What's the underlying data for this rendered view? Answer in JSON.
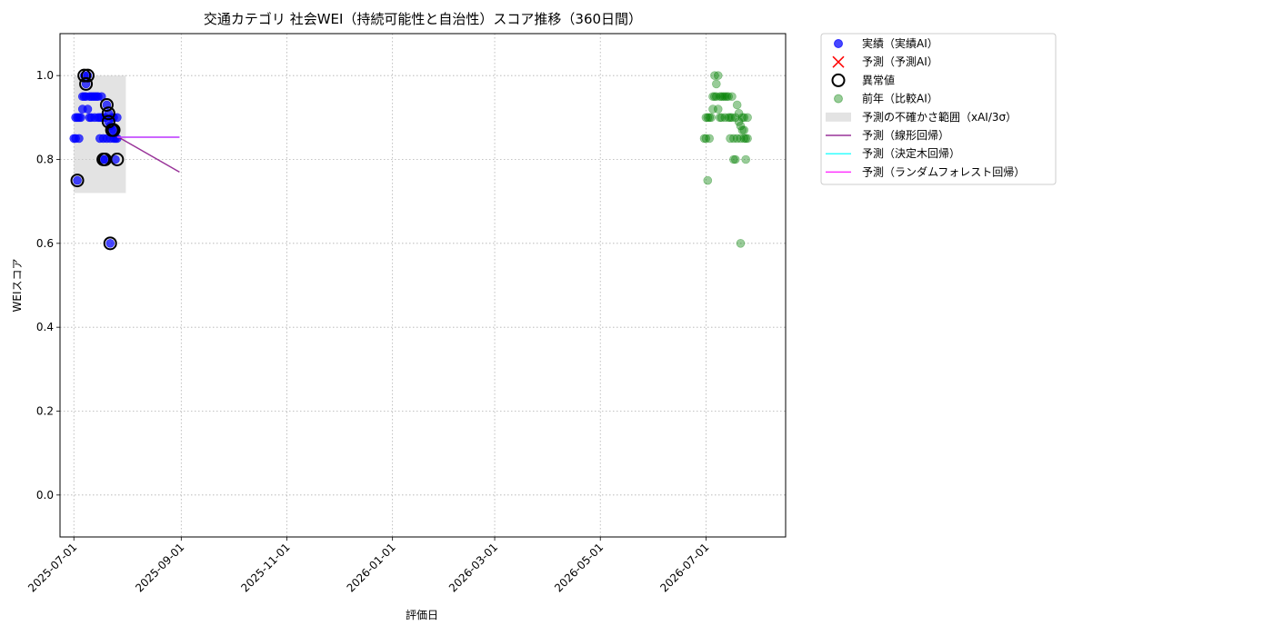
{
  "chart_data": {
    "type": "scatter",
    "title": "交通カテゴリ 社会WEI（持続可能性と自治性）スコア推移（360日間）",
    "xlabel": "評価日",
    "ylabel": "WEIスコア",
    "xlim": [
      "2025-06-23",
      "2026-08-16"
    ],
    "ylim": [
      -0.1,
      1.1
    ],
    "grid": true,
    "legend_position": "outside-top-right",
    "x_tick_labels": [
      "2025-07-01",
      "2025-09-01",
      "2025-11-01",
      "2026-01-01",
      "2026-03-01",
      "2026-05-01",
      "2026-07-01"
    ],
    "y_tick_values": [
      0.0,
      0.2,
      0.4,
      0.6,
      0.8,
      1.0
    ],
    "y_tick_labels": [
      "0.0",
      "0.2",
      "0.4",
      "0.6",
      "0.8",
      "1.0"
    ],
    "series": [
      {
        "name": "実績（実績AI）",
        "kind": "scatter",
        "color": "#0000ff",
        "points": [
          [
            "2025-07-01",
            0.85
          ],
          [
            "2025-07-02",
            0.85
          ],
          [
            "2025-07-02",
            0.9
          ],
          [
            "2025-07-03",
            0.75
          ],
          [
            "2025-07-03",
            0.9
          ],
          [
            "2025-07-04",
            0.85
          ],
          [
            "2025-07-04",
            0.9
          ],
          [
            "2025-07-05",
            0.9
          ],
          [
            "2025-07-06",
            0.92
          ],
          [
            "2025-07-06",
            0.95
          ],
          [
            "2025-07-07",
            0.95
          ],
          [
            "2025-07-07",
            1.0
          ],
          [
            "2025-07-08",
            0.98
          ],
          [
            "2025-07-08",
            0.95
          ],
          [
            "2025-07-09",
            1.0
          ],
          [
            "2025-07-09",
            0.92
          ],
          [
            "2025-07-10",
            0.9
          ],
          [
            "2025-07-10",
            0.95
          ],
          [
            "2025-07-11",
            0.95
          ],
          [
            "2025-07-11",
            0.9
          ],
          [
            "2025-07-12",
            0.95
          ],
          [
            "2025-07-13",
            0.9
          ],
          [
            "2025-07-13",
            0.95
          ],
          [
            "2025-07-14",
            0.95
          ],
          [
            "2025-07-15",
            0.9
          ],
          [
            "2025-07-15",
            0.95
          ],
          [
            "2025-07-16",
            0.85
          ],
          [
            "2025-07-16",
            0.9
          ],
          [
            "2025-07-17",
            0.9
          ],
          [
            "2025-07-17",
            0.95
          ],
          [
            "2025-07-18",
            0.85
          ],
          [
            "2025-07-18",
            0.8
          ],
          [
            "2025-07-19",
            0.8
          ],
          [
            "2025-07-19",
            0.9
          ],
          [
            "2025-07-20",
            0.93
          ],
          [
            "2025-07-20",
            0.85
          ],
          [
            "2025-07-21",
            0.89
          ],
          [
            "2025-07-21",
            0.91
          ],
          [
            "2025-07-22",
            0.6
          ],
          [
            "2025-07-22",
            0.88
          ],
          [
            "2025-07-22",
            0.85
          ],
          [
            "2025-07-23",
            0.87
          ],
          [
            "2025-07-23",
            0.9
          ],
          [
            "2025-07-24",
            0.85
          ],
          [
            "2025-07-24",
            0.87
          ],
          [
            "2025-07-24",
            0.9
          ],
          [
            "2025-07-25",
            0.85
          ],
          [
            "2025-07-25",
            0.8
          ],
          [
            "2025-07-26",
            0.85
          ],
          [
            "2025-07-26",
            0.9
          ]
        ]
      },
      {
        "name": "予測（予測AI）",
        "kind": "scatter-x",
        "color": "#ff0000",
        "points": []
      },
      {
        "name": "異常値",
        "kind": "ring",
        "color": "#000000",
        "points": [
          [
            "2025-07-03",
            0.75
          ],
          [
            "2025-07-07",
            1.0
          ],
          [
            "2025-07-08",
            0.98
          ],
          [
            "2025-07-09",
            1.0
          ],
          [
            "2025-07-18",
            0.8
          ],
          [
            "2025-07-19",
            0.8
          ],
          [
            "2025-07-20",
            0.93
          ],
          [
            "2025-07-21",
            0.91
          ],
          [
            "2025-07-21",
            0.89
          ],
          [
            "2025-07-22",
            0.6
          ],
          [
            "2025-07-23",
            0.87
          ],
          [
            "2025-07-24",
            0.87
          ],
          [
            "2025-07-26",
            0.8
          ]
        ]
      },
      {
        "name": "前年（比較AI）",
        "kind": "scatter",
        "color": "#008000",
        "points": [
          [
            "2026-06-30",
            0.85
          ],
          [
            "2026-07-01",
            0.85
          ],
          [
            "2026-07-01",
            0.9
          ],
          [
            "2026-07-02",
            0.75
          ],
          [
            "2026-07-02",
            0.9
          ],
          [
            "2026-07-03",
            0.85
          ],
          [
            "2026-07-03",
            0.9
          ],
          [
            "2026-07-04",
            0.9
          ],
          [
            "2026-07-05",
            0.92
          ],
          [
            "2026-07-05",
            0.95
          ],
          [
            "2026-07-06",
            0.95
          ],
          [
            "2026-07-06",
            1.0
          ],
          [
            "2026-07-07",
            0.98
          ],
          [
            "2026-07-07",
            0.95
          ],
          [
            "2026-07-08",
            1.0
          ],
          [
            "2026-07-08",
            0.92
          ],
          [
            "2026-07-09",
            0.9
          ],
          [
            "2026-07-09",
            0.95
          ],
          [
            "2026-07-10",
            0.95
          ],
          [
            "2026-07-10",
            0.9
          ],
          [
            "2026-07-11",
            0.95
          ],
          [
            "2026-07-12",
            0.9
          ],
          [
            "2026-07-12",
            0.95
          ],
          [
            "2026-07-13",
            0.95
          ],
          [
            "2026-07-14",
            0.9
          ],
          [
            "2026-07-14",
            0.95
          ],
          [
            "2026-07-15",
            0.85
          ],
          [
            "2026-07-15",
            0.9
          ],
          [
            "2026-07-16",
            0.9
          ],
          [
            "2026-07-16",
            0.95
          ],
          [
            "2026-07-17",
            0.85
          ],
          [
            "2026-07-17",
            0.8
          ],
          [
            "2026-07-18",
            0.8
          ],
          [
            "2026-07-18",
            0.9
          ],
          [
            "2026-07-19",
            0.93
          ],
          [
            "2026-07-19",
            0.85
          ],
          [
            "2026-07-20",
            0.89
          ],
          [
            "2026-07-20",
            0.91
          ],
          [
            "2026-07-21",
            0.6
          ],
          [
            "2026-07-21",
            0.88
          ],
          [
            "2026-07-21",
            0.85
          ],
          [
            "2026-07-22",
            0.87
          ],
          [
            "2026-07-22",
            0.9
          ],
          [
            "2026-07-23",
            0.85
          ],
          [
            "2026-07-23",
            0.87
          ],
          [
            "2026-07-23",
            0.9
          ],
          [
            "2026-07-24",
            0.85
          ],
          [
            "2026-07-24",
            0.8
          ],
          [
            "2026-07-25",
            0.85
          ],
          [
            "2026-07-25",
            0.9
          ]
        ]
      },
      {
        "name": "予測の不確かさ範囲（xAI/3σ）",
        "kind": "band",
        "color": "#cccccc",
        "x_range": [
          "2025-07-01",
          "2025-07-31"
        ],
        "y_range": [
          0.72,
          1.0
        ]
      },
      {
        "name": "予測（線形回帰）",
        "kind": "line",
        "color": "#800080",
        "points": [
          [
            "2025-07-26",
            0.855
          ],
          [
            "2025-08-31",
            0.77
          ]
        ]
      },
      {
        "name": "予測（決定木回帰）",
        "kind": "line",
        "color": "#00ffff",
        "points": [
          [
            "2025-07-26",
            0.853
          ],
          [
            "2025-08-31",
            0.853
          ]
        ]
      },
      {
        "name": "予測（ランダムフォレスト回帰）",
        "kind": "line",
        "color": "#ff00ff",
        "points": [
          [
            "2025-07-26",
            0.853
          ],
          [
            "2025-08-31",
            0.853
          ]
        ]
      }
    ]
  }
}
